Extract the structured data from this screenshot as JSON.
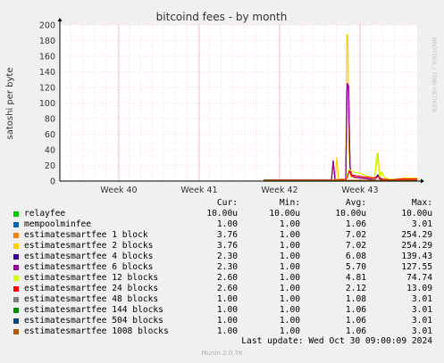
{
  "title": "bitcoind fees - by month",
  "ylabel": "satoshi per byte",
  "watermark": "RRDTOOL / TOBI OETIKER",
  "legend_headers": {
    "cur": "Cur:",
    "min": "Min:",
    "avg": "Avg:",
    "max": "Max:"
  },
  "legend": [
    {
      "name": "relayfee",
      "color": "#00cc00",
      "cur": "10.00u",
      "min": "10.00u",
      "avg": "10.00u",
      "max": "10.00u"
    },
    {
      "name": "mempoolminfee",
      "color": "#0066b3",
      "cur": "1.00",
      "min": "1.00",
      "avg": "1.06",
      "max": "3.01"
    },
    {
      "name": "estimatesmartfee 1 block",
      "color": "#ff8000",
      "cur": "3.76",
      "min": "1.00",
      "avg": "7.02",
      "max": "254.29"
    },
    {
      "name": "estimatesmartfee 2 blocks",
      "color": "#ffcc00",
      "cur": "3.76",
      "min": "1.00",
      "avg": "7.02",
      "max": "254.29"
    },
    {
      "name": "estimatesmartfee 4 blocks",
      "color": "#330099",
      "cur": "2.30",
      "min": "1.00",
      "avg": "6.08",
      "max": "139.43"
    },
    {
      "name": "estimatesmartfee 6 blocks",
      "color": "#990099",
      "cur": "2.30",
      "min": "1.00",
      "avg": "5.70",
      "max": "127.55"
    },
    {
      "name": "estimatesmartfee 12 blocks",
      "color": "#ccff00",
      "cur": "2.60",
      "min": "1.00",
      "avg": "4.81",
      "max": "74.74"
    },
    {
      "name": "estimatesmartfee 24 blocks",
      "color": "#ff0000",
      "cur": "2.60",
      "min": "1.00",
      "avg": "2.12",
      "max": "13.09"
    },
    {
      "name": "estimatesmartfee 48 blocks",
      "color": "#808080",
      "cur": "1.00",
      "min": "1.00",
      "avg": "1.08",
      "max": "3.01"
    },
    {
      "name": "estimatesmartfee 144 blocks",
      "color": "#008f00",
      "cur": "1.00",
      "min": "1.00",
      "avg": "1.06",
      "max": "3.01"
    },
    {
      "name": "estimatesmartfee 504 blocks",
      "color": "#00487d",
      "cur": "1.00",
      "min": "1.00",
      "avg": "1.06",
      "max": "3.01"
    },
    {
      "name": "estimatesmartfee 1008 blocks",
      "color": "#b35a00",
      "cur": "1.00",
      "min": "1.00",
      "avg": "1.06",
      "max": "3.01"
    }
  ],
  "last_update": "Last update: Wed Oct 30 09:00:09 2024",
  "footer": "Munin 2.0.76",
  "chart_data": {
    "type": "line",
    "title": "bitcoind fees - by month",
    "ylabel": "satoshi per byte",
    "xlabel": "",
    "ylim": [
      0,
      200
    ],
    "yticks": [
      0,
      20,
      40,
      60,
      80,
      100,
      120,
      140,
      160,
      180,
      200
    ],
    "xlim": [
      0,
      100
    ],
    "xticks": [
      {
        "label": "Week 40",
        "x": 16.5
      },
      {
        "label": "Week 41",
        "x": 39
      },
      {
        "label": "Week 42",
        "x": 61.5
      },
      {
        "label": "Week 43",
        "x": 84
      }
    ],
    "grid": true,
    "series": [
      {
        "name": "relayfee",
        "color": "#00cc00",
        "x": [
          57,
          100
        ],
        "y": [
          1e-05,
          1e-05
        ]
      },
      {
        "name": "mempoolminfee",
        "color": "#0066b3",
        "x": [
          57,
          100
        ],
        "y": [
          1,
          1
        ]
      },
      {
        "name": "estimatesmartfee 2 blocks",
        "color": "#ffcc00",
        "x": [
          57,
          76,
          76.5,
          77,
          77.5,
          78,
          79,
          80,
          80.3,
          80.6,
          80.9,
          81.2,
          81.5,
          82.5,
          84,
          85,
          88,
          89,
          89.5,
          90,
          91,
          93,
          94,
          95,
          96,
          100
        ],
        "y": [
          1.5,
          1.5,
          26,
          2,
          30,
          2,
          3,
          2,
          188,
          185,
          40,
          12,
          5,
          4,
          4,
          4,
          2,
          36,
          8,
          12,
          3,
          2,
          1.5,
          2,
          3.76,
          3.76
        ]
      },
      {
        "name": "estimatesmartfee 4 blocks",
        "color": "#330099",
        "x": [
          57,
          76,
          76.5,
          77,
          78,
          80,
          80.4,
          80.8,
          81.2,
          81.6,
          82.5,
          84,
          86,
          88,
          89,
          89.5,
          90,
          92,
          96,
          100
        ],
        "y": [
          1.2,
          1.2,
          26,
          2,
          2,
          2,
          123,
          120,
          20,
          7,
          5,
          4,
          3,
          2,
          8,
          3,
          2,
          1.5,
          2.3,
          2.3
        ]
      },
      {
        "name": "estimatesmartfee 6 blocks",
        "color": "#990099",
        "x": [
          57,
          76,
          76.5,
          77,
          78,
          80,
          80.4,
          80.8,
          81.2,
          81.6,
          82.5,
          84,
          86,
          88,
          89,
          90,
          96,
          100
        ],
        "y": [
          1.2,
          1.2,
          24,
          2,
          2,
          2,
          125,
          122,
          18,
          7,
          5,
          4,
          3,
          2,
          6,
          2,
          2.3,
          2.3
        ]
      },
      {
        "name": "estimatesmartfee 12 blocks",
        "color": "#ccff00",
        "x": [
          57,
          76,
          77,
          78,
          80,
          80.4,
          81,
          82,
          84,
          88,
          88.7,
          89.5,
          90,
          91,
          92,
          93,
          96,
          100
        ],
        "y": [
          1.1,
          1.1,
          2,
          2,
          2,
          8,
          15,
          12,
          10,
          3,
          35,
          5,
          10,
          4,
          3,
          2,
          2.6,
          2.6
        ]
      },
      {
        "name": "estimatesmartfee 24 blocks",
        "color": "#ff0000",
        "x": [
          57,
          76,
          77,
          78,
          80,
          80.5,
          81,
          81.5,
          84,
          88,
          89,
          90,
          91,
          93,
          95,
          100
        ],
        "y": [
          1,
          1,
          1.5,
          1.5,
          2,
          6,
          13,
          8,
          6,
          4,
          6,
          3,
          2,
          1.5,
          2.6,
          2.6
        ]
      },
      {
        "name": "estimatesmartfee 1008 blocks",
        "color": "#b35a00",
        "x": [
          57,
          100
        ],
        "y": [
          1,
          1
        ]
      }
    ]
  }
}
